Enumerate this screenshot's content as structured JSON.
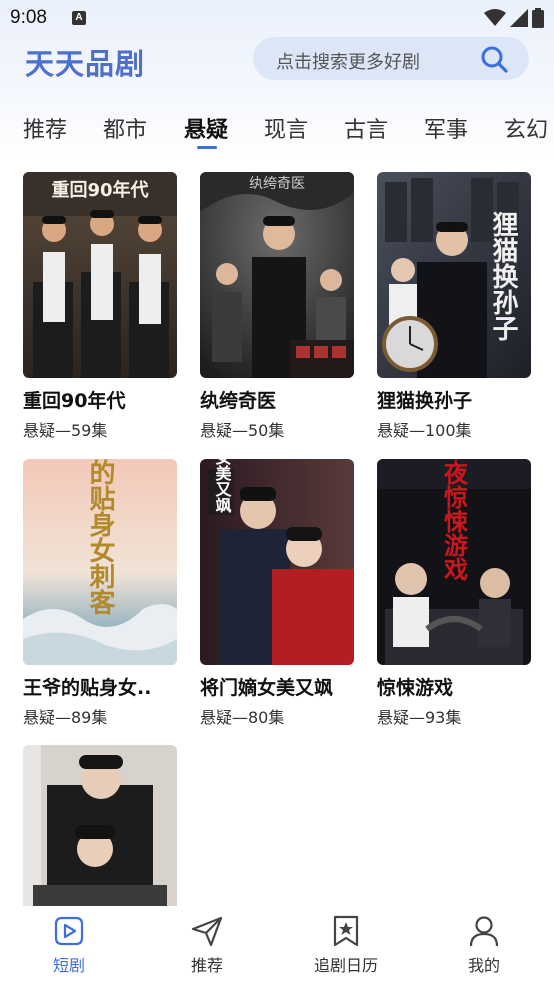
{
  "status": {
    "time": "9:08",
    "a_icon": "A",
    "icons": [
      "wifi-icon",
      "signal-icon",
      "battery-icon"
    ]
  },
  "header": {
    "title": "天天品剧",
    "search_placeholder": "点击搜索更多好剧",
    "search_icon": "search-icon"
  },
  "tabs": [
    {
      "label": "推荐",
      "active": false
    },
    {
      "label": "都市",
      "active": false
    },
    {
      "label": "悬疑",
      "active": true
    },
    {
      "label": "现言",
      "active": false
    },
    {
      "label": "古言",
      "active": false
    },
    {
      "label": "军事",
      "active": false
    },
    {
      "label": "玄幻",
      "active": false
    }
  ],
  "dramas": [
    {
      "title": "重回90年代",
      "meta": "悬疑—59集",
      "poster_text": "重回90年代"
    },
    {
      "title": "纨绔奇医",
      "meta": "悬疑—50集",
      "poster_text": "纨绔奇医"
    },
    {
      "title": "狸猫换孙子",
      "meta": "悬疑—100集",
      "poster_text": "狸猫换孙子"
    },
    {
      "title": "王爷的贴身女..",
      "meta": "悬疑—89集",
      "poster_text": "王爷的贴身女刺客"
    },
    {
      "title": "将门嫡女美又飒",
      "meta": "悬疑—80集",
      "poster_text": "嫡女美又飒"
    },
    {
      "title": "惊悚游戏",
      "meta": "悬疑—93集",
      "poster_text": "午夜惊悚游戏"
    },
    {
      "title": "",
      "meta": "",
      "poster_text": ""
    }
  ],
  "bottom_nav": [
    {
      "label": "短剧",
      "icon": "play-icon",
      "active": true
    },
    {
      "label": "推荐",
      "icon": "send-icon",
      "active": false
    },
    {
      "label": "追剧日历",
      "icon": "bookmark-star-icon",
      "active": false
    },
    {
      "label": "我的",
      "icon": "user-icon",
      "active": false
    }
  ],
  "colors": {
    "accent": "#3b6fe0",
    "title": "#4f6fcf",
    "search_bg": "#dde6f7"
  }
}
